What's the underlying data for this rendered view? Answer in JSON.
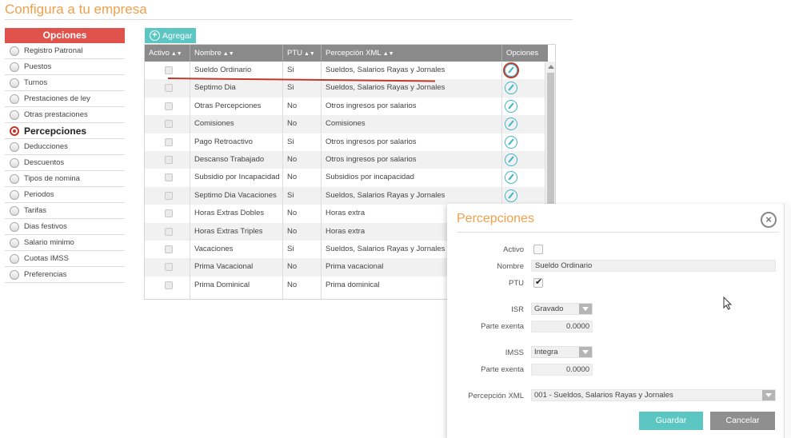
{
  "page": {
    "title": "Configura a tu empresa"
  },
  "sidebar": {
    "header": "Opciones",
    "items": [
      {
        "label": "Registro Patronal",
        "active": false
      },
      {
        "label": "Puestos",
        "active": false
      },
      {
        "label": "Turnos",
        "active": false
      },
      {
        "label": "Prestaciones de ley",
        "active": false
      },
      {
        "label": "Otras prestaciones",
        "active": false
      },
      {
        "label": "Percepciones",
        "active": true
      },
      {
        "label": "Deducciones",
        "active": false
      },
      {
        "label": "Descuentos",
        "active": false
      },
      {
        "label": "Tipos de nomina",
        "active": false
      },
      {
        "label": "Periodos",
        "active": false
      },
      {
        "label": "Tarifas",
        "active": false
      },
      {
        "label": "Dias festivos",
        "active": false
      },
      {
        "label": "Salario minimo",
        "active": false
      },
      {
        "label": "Cuotas IMSS",
        "active": false
      },
      {
        "label": "Preferencias",
        "active": false
      }
    ]
  },
  "toolbar": {
    "add_label": "Agregar"
  },
  "table": {
    "columns": {
      "activo": "Activo",
      "nombre": "Nombre",
      "ptu": "PTU",
      "percepcion_xml": "Percepción XML",
      "opciones": "Opciones"
    },
    "rows": [
      {
        "nombre": "Sueldo Ordinario",
        "ptu": "Si",
        "xml": "Sueldos, Salarios Rayas y Jornales",
        "has_edit": true,
        "highlight": true
      },
      {
        "nombre": "Septimo Dia",
        "ptu": "Si",
        "xml": "Sueldos, Salarios Rayas y Jornales",
        "has_edit": true
      },
      {
        "nombre": "Otras Percepciones",
        "ptu": "No",
        "xml": "Otros ingresos por salarios",
        "has_edit": true
      },
      {
        "nombre": "Comisiones",
        "ptu": "No",
        "xml": "Comisiones",
        "has_edit": true
      },
      {
        "nombre": "Pago Retroactivo",
        "ptu": "Si",
        "xml": "Otros ingresos por salarios",
        "has_edit": true
      },
      {
        "nombre": "Descanso Trabajado",
        "ptu": "No",
        "xml": "Otros ingresos por salarios",
        "has_edit": true
      },
      {
        "nombre": "Subsidio por Incapacidad",
        "ptu": "No",
        "xml": "Subsidios por incapacidad",
        "has_edit": true
      },
      {
        "nombre": "Septimo Dia Vacaciones",
        "ptu": "Si",
        "xml": "Sueldos, Salarios Rayas y Jornales",
        "has_edit": true
      },
      {
        "nombre": "Horas Extras Dobles",
        "ptu": "No",
        "xml": "Horas extra",
        "has_edit": false
      },
      {
        "nombre": "Horas Extras Triples",
        "ptu": "No",
        "xml": "Horas extra",
        "has_edit": false
      },
      {
        "nombre": "Vacaciones",
        "ptu": "Si",
        "xml": "Sueldos, Salarios Rayas y Jornales",
        "has_edit": false
      },
      {
        "nombre": "Prima Vacacional",
        "ptu": "No",
        "xml": "Prima vacacional",
        "has_edit": false
      },
      {
        "nombre": "Prima Dominical",
        "ptu": "No",
        "xml": "Prima dominical",
        "has_edit": false
      }
    ]
  },
  "modal": {
    "title": "Percepciones",
    "close_icon": "×",
    "labels": {
      "activo": "Activo",
      "nombre": "Nombre",
      "ptu": "PTU",
      "isr": "ISR",
      "parte_exenta_isr": "Parte exenta",
      "imss": "IMSS",
      "parte_exenta_imss": "Parte exenta",
      "percepcion_xml": "Percepción XML"
    },
    "values": {
      "activo": false,
      "nombre": "Sueldo Ordinario",
      "ptu": true,
      "isr": "Gravado",
      "parte_exenta_isr": "0.0000",
      "imss": "Integra",
      "parte_exenta_imss": "0.0000",
      "percepcion_xml": "001 - Sueldos, Salarios Rayas y Jornales"
    },
    "buttons": {
      "save": "Guardar",
      "cancel": "Cancelar"
    }
  },
  "colors": {
    "accent_orange": "#f0a04b",
    "sidebar_header": "#e0534d",
    "teal": "#5cc6c2",
    "header_gray": "#8a8a8a"
  }
}
